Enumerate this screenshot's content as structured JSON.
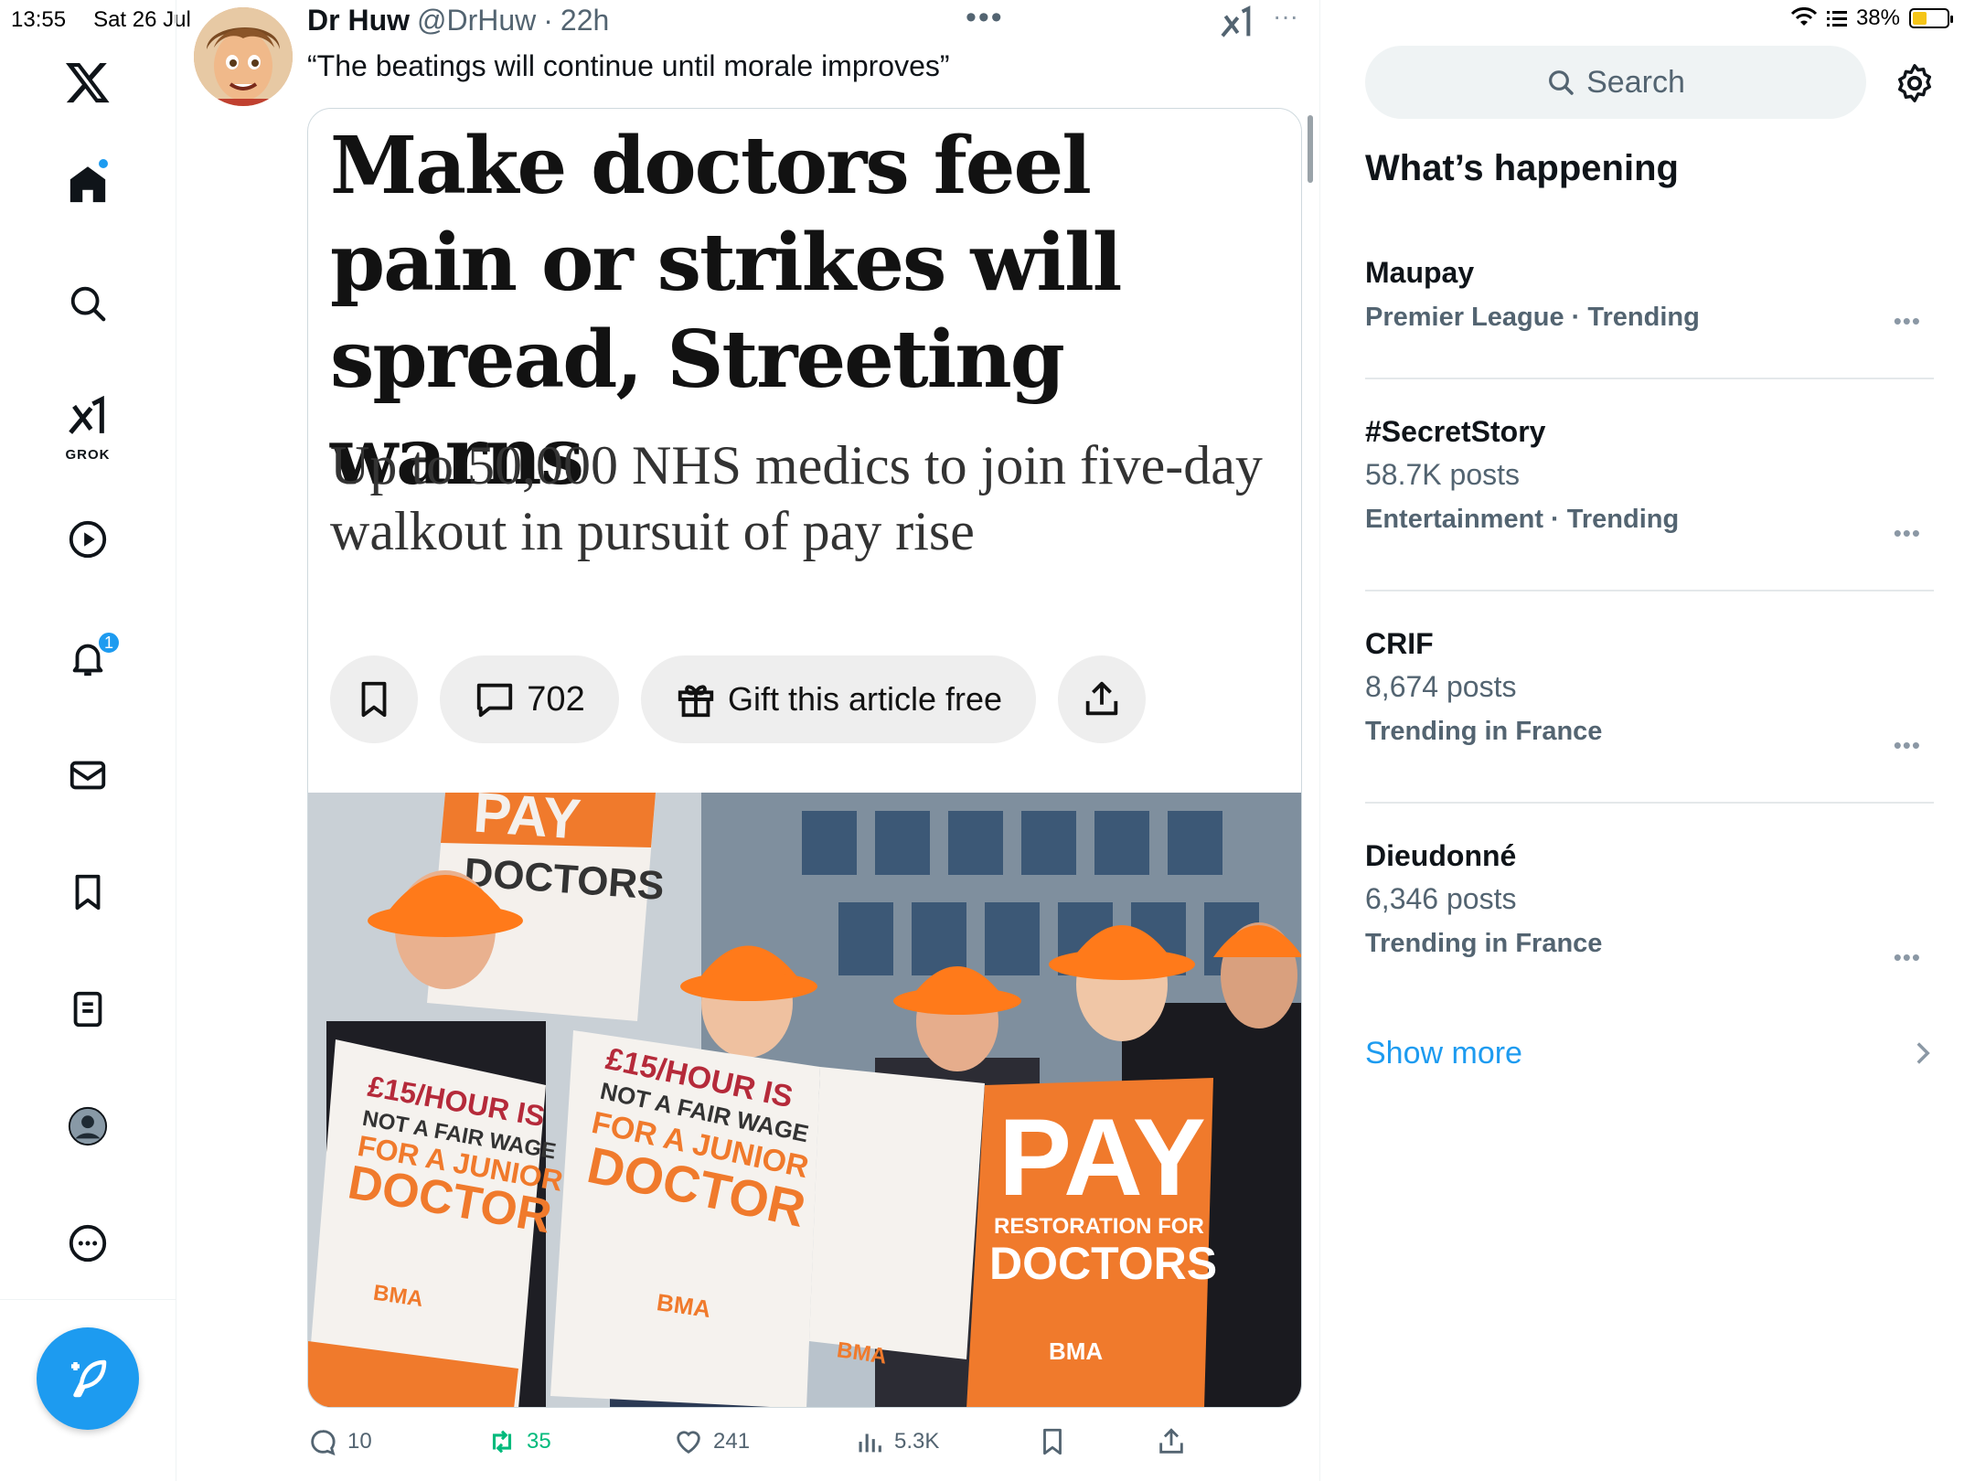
{
  "status_bar": {
    "time": "13:55",
    "date": "Sat 26 Jul",
    "battery": "38%",
    "battery_level": 0.38
  },
  "nav": {
    "items": [
      "x-logo",
      "home-icon",
      "search-icon",
      "grok-icon",
      "video-icon",
      "bell-icon",
      "mail-icon",
      "bookmark-icon",
      "list-icon",
      "profile-icon",
      "more-icon"
    ],
    "grok_label": "GROK",
    "notification_count": "1"
  },
  "tweet": {
    "name": "Dr Huw",
    "handle": "@DrHuw",
    "separator": "·",
    "time": "22h",
    "text": "“The beatings will continue until morale improves”",
    "menu": "•••",
    "grok_menu": "···"
  },
  "article": {
    "headline": "Make doctors feel pain or strikes will spread, Streeting warns",
    "subhead": "Up to 50,000 NHS medics to join five-day walkout in pursuit of pay rise",
    "comments_count": "702",
    "gift_label": "Gift this article free",
    "photo_signs": {
      "pay": "PAY",
      "restoration_for": "RESTORATION FOR",
      "doctors": "DOCTORS",
      "fair_wage_1": "£15/HOUR IS",
      "fair_wage_2": "NOT A FAIR WAGE",
      "fair_wage_3": "FOR A JUNIOR",
      "fair_wage_4": "DOCTOR",
      "bma": "BMA"
    }
  },
  "actions": {
    "replies": "10",
    "reposts": "35",
    "likes": "241",
    "views": "5.3K"
  },
  "sidebar": {
    "search_placeholder": "Search",
    "section_title": "What’s happening",
    "trends": [
      {
        "name": "Maupay",
        "posts": "",
        "meta": "Premier League · Trending"
      },
      {
        "name": "#SecretStory",
        "posts": "58.7K posts",
        "meta": "Entertainment · Trending"
      },
      {
        "name": "CRIF",
        "posts": "8,674 posts",
        "meta": "Trending in France"
      },
      {
        "name": "Dieudonné",
        "posts": "6,346 posts",
        "meta": "Trending in France"
      }
    ],
    "more_dots": "•••",
    "show_more": "Show more"
  },
  "colors": {
    "accent": "#1d9bf0",
    "repost": "#00ba7c",
    "text": "#0f1419",
    "muted": "#536471",
    "sign_orange": "#f07a2c"
  }
}
